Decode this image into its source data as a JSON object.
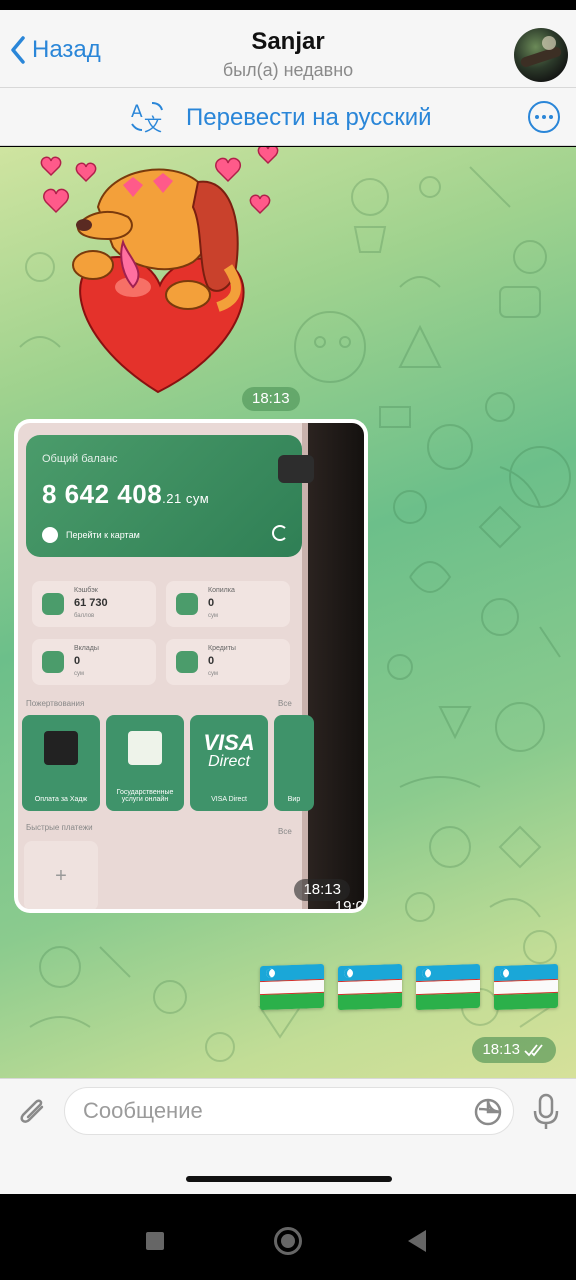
{
  "header": {
    "back_label": "Назад",
    "contact_name": "Sanjar",
    "status": "был(а) недавно"
  },
  "translate_bar": {
    "label": "Перевести на русский"
  },
  "messages": {
    "sticker_time": "18:13",
    "photo_time": "18:13",
    "photo_overlay_time_partial": "19:0",
    "flags_time": "18:13",
    "flags_emoji": [
      "🇺🇿",
      "🇺🇿",
      "🇺🇿",
      "🇺🇿"
    ],
    "flags_read_status": "double-check-icon"
  },
  "photo_content": {
    "balance_label": "Общий баланс",
    "balance_amount": "8 642 408",
    "balance_cents": ".21 сум",
    "go_to_cards": "Перейти к картам",
    "cashback_label": "Кэшбэк",
    "cashback_value": "61 730",
    "cashback_unit": "баллов",
    "savings_label": "Копилка",
    "savings_value": "0",
    "savings_unit": "сум",
    "deposits_label": "Вклады",
    "deposits_value": "0",
    "deposits_unit": "сум",
    "credits_label": "Кредиты",
    "credits_value": "0",
    "credits_unit": "сум",
    "payments_section": "Пожертвования",
    "all_label": "Все",
    "tile1": "Оплата за Хадж",
    "tile2": "Государственные услуги онлайн",
    "tile3_title": "VISA",
    "tile3_sub": "Direct",
    "tile3_label": "VISA Direct",
    "tile4": "Вир",
    "quick_section": "Быстрые платежи",
    "quick_all": "Все"
  },
  "input": {
    "placeholder": "Сообщение"
  },
  "colors": {
    "accent": "#2a86d8",
    "header_bg": "#f6f6f6",
    "chat_green": "#6cbf8a"
  }
}
